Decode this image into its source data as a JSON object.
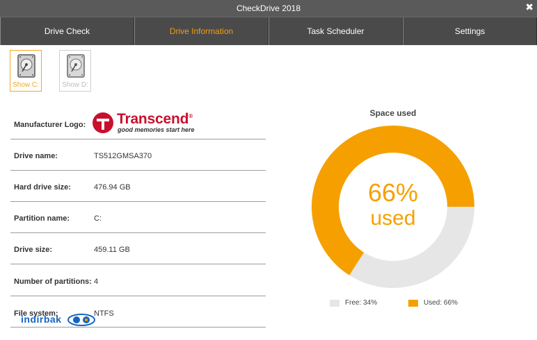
{
  "window": {
    "title": "CheckDrive 2018",
    "close_glyph": "✖"
  },
  "tabs": [
    {
      "label": "Drive Check",
      "active": false
    },
    {
      "label": "Drive Information",
      "active": true
    },
    {
      "label": "Task Scheduler",
      "active": false
    },
    {
      "label": "Settings",
      "active": false
    }
  ],
  "drives": [
    {
      "label": "Show C:",
      "active": true,
      "icon": "hard-drive-icon"
    },
    {
      "label": "Show D:",
      "active": false,
      "icon": "hard-drive-icon"
    }
  ],
  "info": {
    "manufacturer_logo_label": "Manufacturer Logo:",
    "logo": {
      "brand": "Transcend",
      "tagline": "good memories start here",
      "reg": "®"
    },
    "rows": [
      {
        "key": "Drive name:",
        "value": "TS512GMSA370"
      },
      {
        "key": "Hard drive size:",
        "value": "476.94 GB"
      },
      {
        "key": "Partition name:",
        "value": "C:"
      },
      {
        "key": "Drive size:",
        "value": "459.11 GB"
      },
      {
        "key": "Number of partitions:",
        "value": "4"
      },
      {
        "key": "File system:",
        "value": "NTFS"
      }
    ]
  },
  "chart_data": {
    "type": "pie",
    "title": "Space used",
    "center_value": "66%",
    "center_label": "used",
    "series": [
      {
        "name": "Used: 66%",
        "value": 66,
        "color": "#f5a000"
      },
      {
        "name": "Free: 34%",
        "value": 34,
        "color": "#e6e6e6"
      }
    ],
    "legend_placement": "bottom"
  },
  "watermark": {
    "text": "indirbak"
  },
  "colors": {
    "accent": "#f39c12",
    "titlebar": "#5a5a5a",
    "tabbar": "#4a4a4a"
  }
}
